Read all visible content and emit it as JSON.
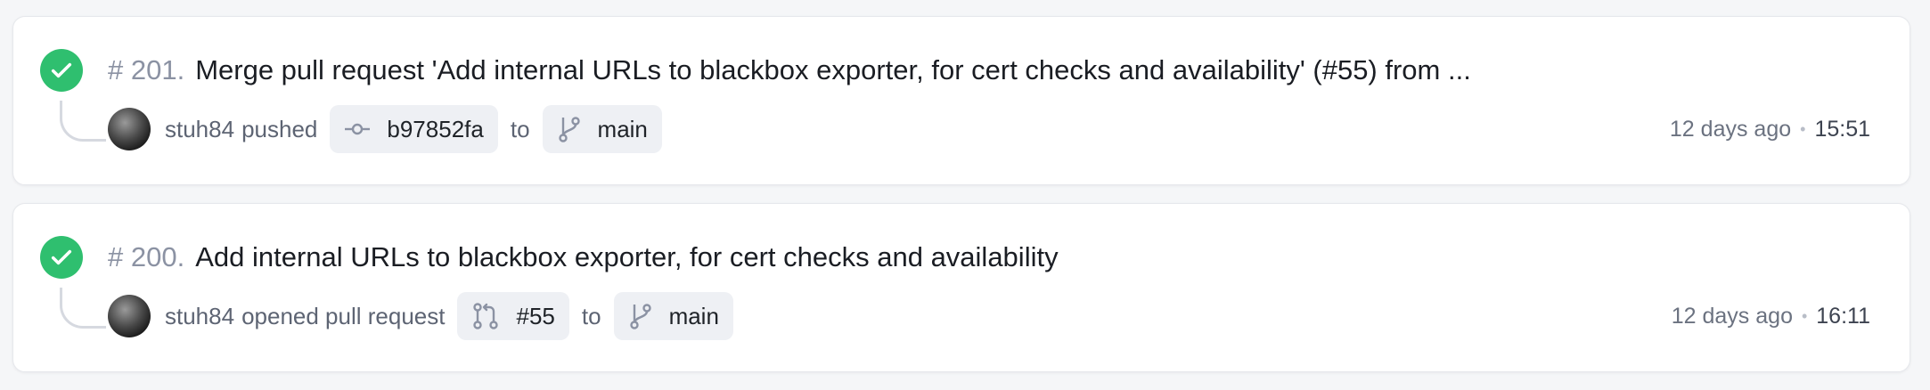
{
  "runs": [
    {
      "number": "# 201.",
      "title": "Merge pull request 'Add internal URLs to blackbox exporter, for cert checks and availability' (#55) from ...",
      "user": "stuh84",
      "action": "pushed",
      "ref_icon": "commit-icon",
      "ref": "b97852fa",
      "to_label": "to",
      "branch": "main",
      "ago": "12 days ago",
      "separator": "•",
      "time": "15:51",
      "status_color": "#2fbf6f"
    },
    {
      "number": "# 200.",
      "title": "Add internal URLs to blackbox exporter, for cert checks and availability",
      "user": "stuh84",
      "action": "opened pull request",
      "ref_icon": "pull-request-icon",
      "ref": "#55",
      "to_label": "to",
      "branch": "main",
      "ago": "12 days ago",
      "separator": "•",
      "time": "16:11",
      "status_color": "#2fbf6f"
    }
  ]
}
